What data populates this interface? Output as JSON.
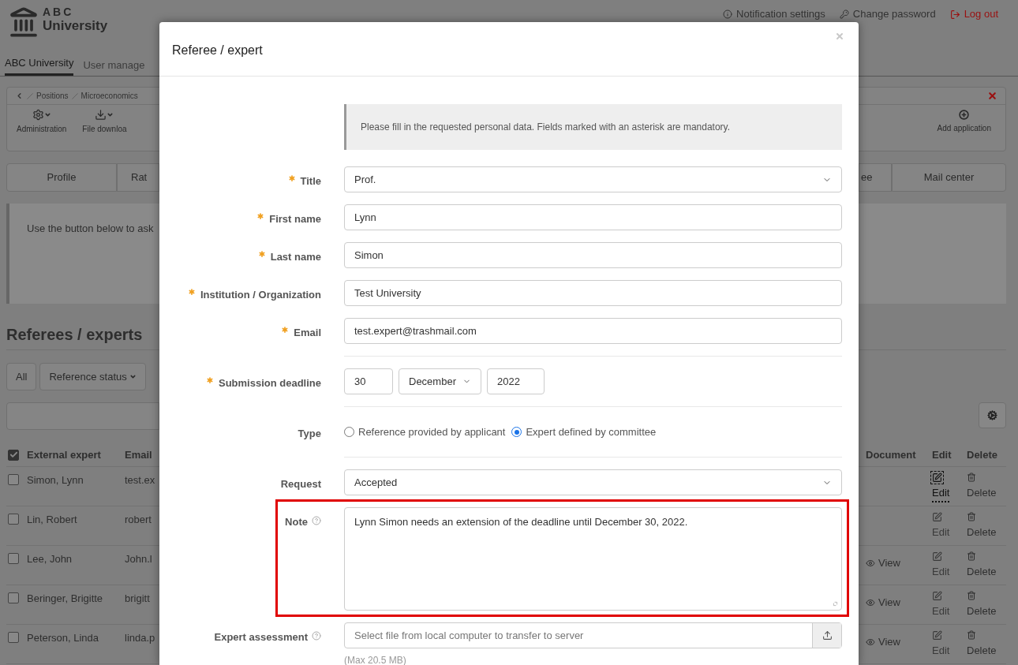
{
  "header": {
    "logo_top": "ABC",
    "logo_bottom": "University",
    "links": [
      {
        "label": "Notification settings",
        "kind": "info"
      },
      {
        "label": "Change password",
        "kind": "key"
      },
      {
        "label": "Log out",
        "kind": "logout"
      }
    ]
  },
  "nav": [
    {
      "label": "ABC University",
      "selected": true
    },
    {
      "label": "User manage",
      "selected": false
    }
  ],
  "breadcrumb": [
    "Positions",
    "Microeconomics"
  ],
  "tools": [
    {
      "label": "Administration",
      "kind": "gears"
    },
    {
      "label": "File downloa",
      "kind": "download"
    }
  ],
  "add_button": "Add application",
  "tabs_left": [
    "Profile",
    "Rat"
  ],
  "tabs_right": [
    "ee",
    "Mail center"
  ],
  "info_text": "Use the button below to ask",
  "section_title": "Referees / experts",
  "filters": [
    {
      "label": "All",
      "dropdown": false
    },
    {
      "label": "Reference status",
      "dropdown": true
    }
  ],
  "table": {
    "all_checked": true,
    "columns_left": [
      "External expert",
      "Email"
    ],
    "columns_right": [
      "Document",
      "Edit",
      "Delete"
    ],
    "rows": [
      {
        "checked": false,
        "name": "Simon, Lynn",
        "email": "test.ex",
        "document": null,
        "edit": "Edit",
        "edit_focused": true,
        "delete": "Delete"
      },
      {
        "checked": false,
        "name": "Lin, Robert",
        "email": "robert",
        "document": null,
        "edit": "Edit",
        "edit_focused": false,
        "delete": "Delete"
      },
      {
        "checked": false,
        "name": "Lee, John",
        "email": "John.l",
        "document": "View",
        "edit": "Edit",
        "edit_focused": false,
        "delete": "Delete"
      },
      {
        "checked": false,
        "name": "Beringer, Brigitte",
        "email": "brigitt",
        "document": "View",
        "edit": "Edit",
        "edit_focused": false,
        "delete": "Delete"
      },
      {
        "checked": false,
        "name": "Peterson, Linda",
        "email": "linda.p",
        "document": "View",
        "edit": "Edit",
        "edit_focused": false,
        "delete": "Delete"
      }
    ]
  },
  "modal": {
    "title": "Referee / expert",
    "info": "Please fill in the requested personal data. Fields marked with an asterisk are mandatory.",
    "fields": [
      {
        "kind": "select",
        "label": "Title",
        "required": true,
        "help": false,
        "highlighted": false,
        "divider_after": false,
        "value": "Prof."
      },
      {
        "kind": "text",
        "label": "First name",
        "required": true,
        "help": false,
        "highlighted": false,
        "divider_after": false,
        "value": "Lynn"
      },
      {
        "kind": "text",
        "label": "Last name",
        "required": true,
        "help": false,
        "highlighted": false,
        "divider_after": false,
        "value": "Simon"
      },
      {
        "kind": "text",
        "label": "Institution / Organization",
        "required": true,
        "help": false,
        "highlighted": false,
        "divider_after": false,
        "value": "Test University"
      },
      {
        "kind": "text",
        "label": "Email",
        "required": true,
        "help": false,
        "highlighted": false,
        "divider_after": true,
        "value": "test.expert@trashmail.com"
      },
      {
        "kind": "date",
        "label": "Submission deadline",
        "required": true,
        "help": false,
        "highlighted": false,
        "divider_after": true,
        "day": "30",
        "month": "December",
        "year": "2022"
      },
      {
        "kind": "radio",
        "label": "Type",
        "required": false,
        "help": false,
        "highlighted": false,
        "divider_after": true,
        "options": [
          {
            "label": "Reference provided by applicant",
            "selected": false
          },
          {
            "label": "Expert defined by committee",
            "selected": true
          }
        ]
      },
      {
        "kind": "select",
        "label": "Request",
        "required": false,
        "help": false,
        "highlighted": false,
        "divider_after": false,
        "value": "Accepted"
      },
      {
        "kind": "textarea",
        "label": "Note",
        "required": false,
        "help": true,
        "highlighted": true,
        "divider_after": false,
        "value": "Lynn Simon needs an extension of the deadline until December 30, 2022."
      },
      {
        "kind": "file",
        "label": "Expert assessment",
        "required": false,
        "help": true,
        "highlighted": false,
        "divider_after": false,
        "placeholder": "Select file from local computer to transfer to server",
        "hint": "(Max 20.5 MB)"
      }
    ]
  }
}
